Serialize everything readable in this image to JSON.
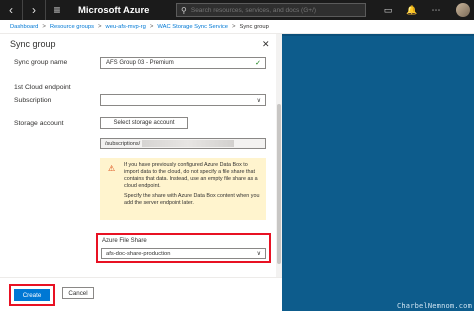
{
  "topbar": {
    "brand": "Microsoft Azure",
    "search_placeholder": "Search resources, services, and docs (G+/)"
  },
  "breadcrumb": [
    "Dashboard",
    "Resource groups",
    "weu-afs-mvp-rg",
    "WAC Storage Sync Service",
    "Sync group"
  ],
  "blade": {
    "title": "Sync group",
    "sync_group_name_label": "Sync group name",
    "sync_group_name_value": "AFS Group 03 - Premium",
    "cloud_endpoint_label": "1st Cloud endpoint",
    "subscription_label": "Subscription",
    "storage_account_label": "Storage account",
    "select_storage_account_label": "Select storage account",
    "storage_path_value": "/subscriptions/",
    "warning_text_1": "If you have previously configured Azure Data Box to import data to the cloud, do not specify a file share that contains that data. Instead, use an empty file share as a cloud endpoint.",
    "warning_text_2": "Specify the share with Azure Data Box content when you add the server endpoint later.",
    "azure_file_share_label": "Azure File Share",
    "azure_file_share_value": "afs-doc-share-production"
  },
  "footer": {
    "create_label": "Create",
    "cancel_label": "Cancel"
  },
  "watermark": "CharbelNemnom.com",
  "colors": {
    "accent": "#0078d4",
    "highlight": "#e81123",
    "side_panel": "#0d5c8c",
    "warning_bg": "#fff4ce"
  }
}
